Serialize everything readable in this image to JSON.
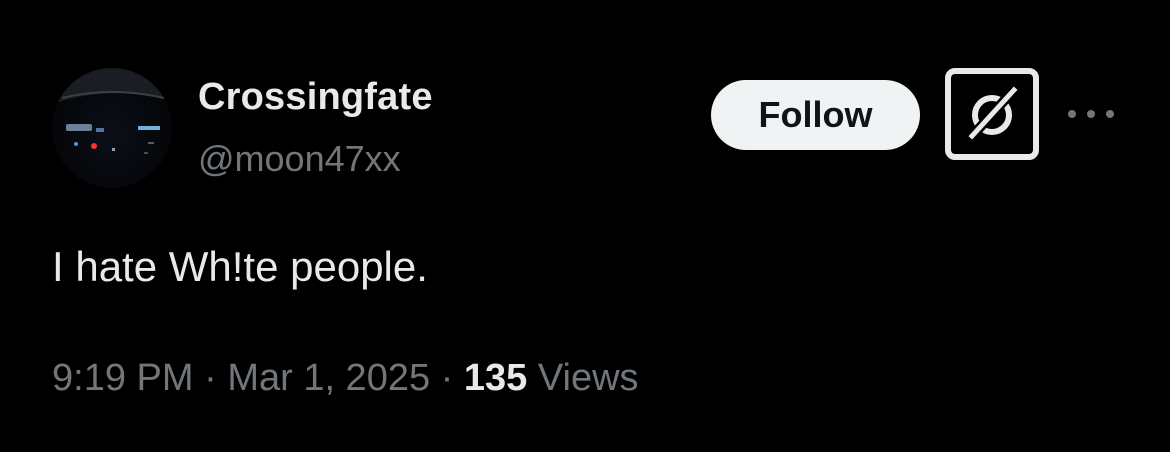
{
  "tweet": {
    "author": {
      "display_name": "Crossingfate",
      "handle": "@moon47xx",
      "avatar": "avatar-photo"
    },
    "actions": {
      "follow_label": "Follow",
      "grok_icon": "grok-icon",
      "more_icon": "more-icon"
    },
    "text": "I hate Wh!te people.",
    "meta": {
      "time": "9:19 PM",
      "separator": "·",
      "date": "Mar 1, 2025",
      "views_count": "135",
      "views_label": "Views"
    }
  },
  "colors": {
    "background": "#000000",
    "primary_text": "#e7e9ea",
    "secondary_text": "#71767b",
    "follow_bg": "#eff3f4",
    "follow_text": "#0f1419"
  }
}
